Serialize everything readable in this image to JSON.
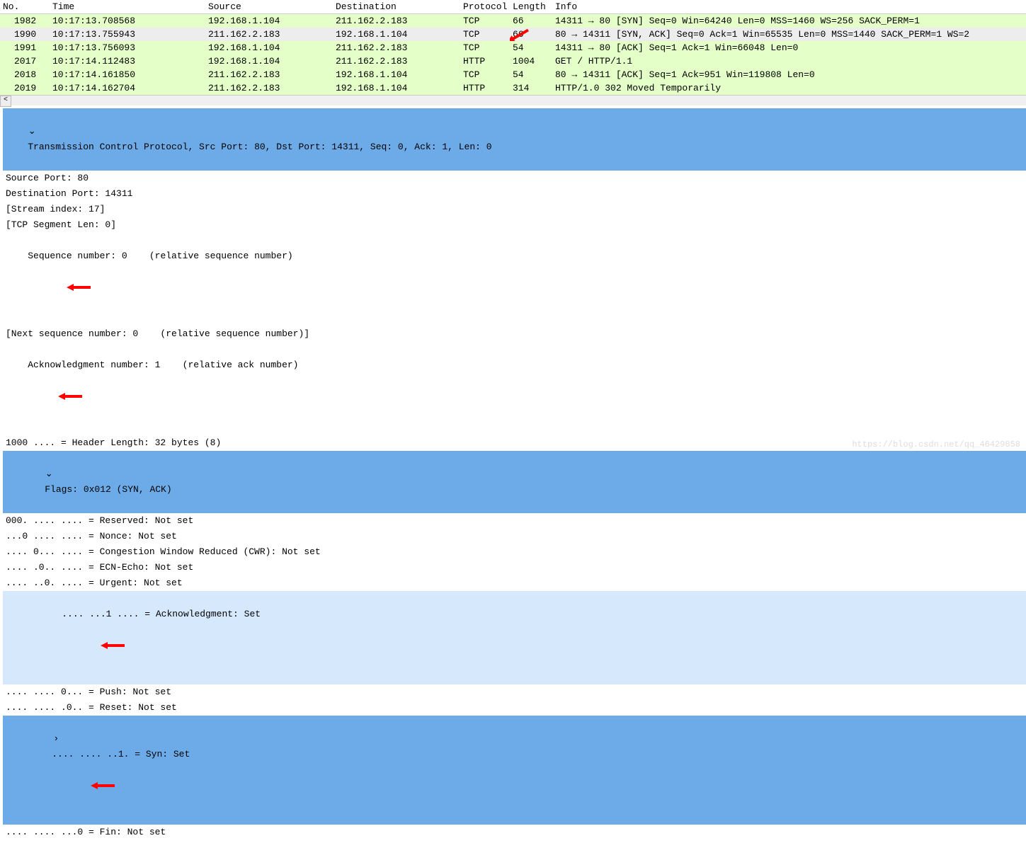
{
  "columns": {
    "no": "No.",
    "time": "Time",
    "source": "Source",
    "destination": "Destination",
    "protocol": "Protocol",
    "length": "Length",
    "info": "Info"
  },
  "packets": [
    {
      "no": "1982",
      "time": "10:17:13.708568",
      "src": "192.168.1.104",
      "dst": "211.162.2.183",
      "proto": "TCP",
      "len": "66",
      "info": "14311 → 80 [SYN] Seq=0 Win=64240 Len=0 MSS=1460 WS=256 SACK_PERM=1",
      "style": "green",
      "arrow": false
    },
    {
      "no": "1990",
      "time": "10:17:13.755943",
      "src": "211.162.2.183",
      "dst": "192.168.1.104",
      "proto": "TCP",
      "len": "66",
      "info": "80 → 14311 [SYN, ACK] Seq=0 Ack=1 Win=65535 Len=0 MSS=1440 SACK_PERM=1 WS=2",
      "style": "selected",
      "arrow": true
    },
    {
      "no": "1991",
      "time": "10:17:13.756093",
      "src": "192.168.1.104",
      "dst": "211.162.2.183",
      "proto": "TCP",
      "len": "54",
      "info": "14311 → 80 [ACK] Seq=1 Ack=1 Win=66048 Len=0",
      "style": "green",
      "arrow": false
    },
    {
      "no": "2017",
      "time": "10:17:14.112483",
      "src": "192.168.1.104",
      "dst": "211.162.2.183",
      "proto": "HTTP",
      "len": "1004",
      "info": "GET / HTTP/1.1",
      "style": "green",
      "arrow": false
    },
    {
      "no": "2018",
      "time": "10:17:14.161850",
      "src": "211.162.2.183",
      "dst": "192.168.1.104",
      "proto": "TCP",
      "len": "54",
      "info": "80 → 14311 [ACK] Seq=1 Ack=951 Win=119808 Len=0",
      "style": "green",
      "arrow": false
    },
    {
      "no": "2019",
      "time": "10:17:14.162704",
      "src": "211.162.2.183",
      "dst": "192.168.1.104",
      "proto": "HTTP",
      "len": "314",
      "info": "HTTP/1.0 302 Moved Temporarily",
      "style": "green",
      "arrow": false
    }
  ],
  "details": {
    "tcp_header": "Transmission Control Protocol, Src Port: 80, Dst Port: 14311, Seq: 0, Ack: 1, Len: 0",
    "src_port": "Source Port: 80",
    "dst_port": "Destination Port: 14311",
    "stream_index": "[Stream index: 17]",
    "tcp_seg_len": "[TCP Segment Len: 0]",
    "seq_num": "Sequence number: 0    (relative sequence number)",
    "next_seq": "[Next sequence number: 0    (relative sequence number)]",
    "ack_num": "Acknowledgment number: 1    (relative ack number)",
    "header_len": "1000 .... = Header Length: 32 bytes (8)",
    "flags_header": "Flags: 0x012 (SYN, ACK)",
    "flag_reserved": "000. .... .... = Reserved: Not set",
    "flag_nonce": "...0 .... .... = Nonce: Not set",
    "flag_cwr": ".... 0... .... = Congestion Window Reduced (CWR): Not set",
    "flag_ecn": ".... .0.. .... = ECN-Echo: Not set",
    "flag_urgent": ".... ..0. .... = Urgent: Not set",
    "flag_ack": ".... ...1 .... = Acknowledgment: Set",
    "flag_push": ".... .... 0... = Push: Not set",
    "flag_reset": ".... .... .0.. = Reset: Not set",
    "flag_syn": ".... .... ..1. = Syn: Set",
    "flag_fin": ".... .... ...0 = Fin: Not set"
  },
  "watermark": "https://blog.csdn.net/qq_46429858"
}
